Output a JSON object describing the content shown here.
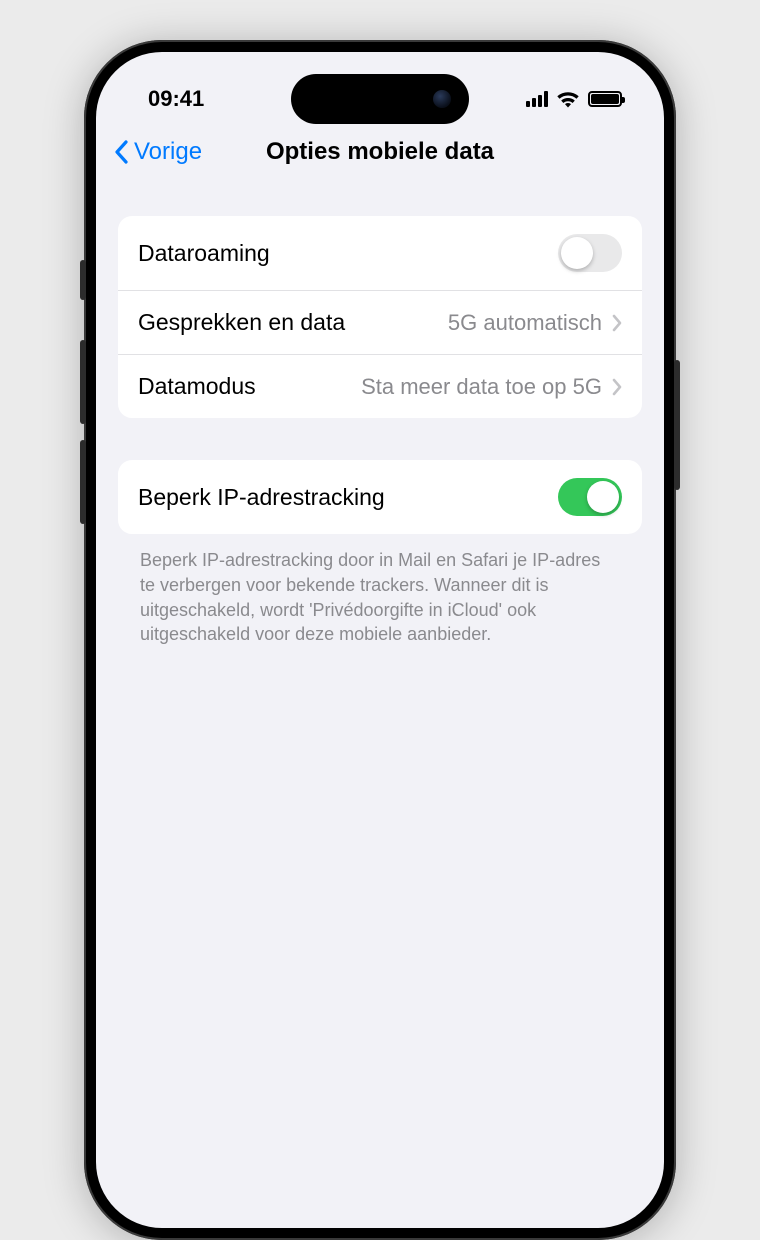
{
  "status": {
    "time": "09:41"
  },
  "nav": {
    "back": "Vorige",
    "title": "Opties mobiele data"
  },
  "group1": {
    "roaming": {
      "label": "Dataroaming",
      "on": false
    },
    "voiceData": {
      "label": "Gesprekken en data",
      "value": "5G automatisch"
    },
    "dataMode": {
      "label": "Datamodus",
      "value": "Sta meer data toe op 5G"
    }
  },
  "group2": {
    "limitIp": {
      "label": "Beperk IP-adrestracking",
      "on": true
    }
  },
  "footer": "Beperk IP-adrestracking door in Mail en Safari je IP-adres te verbergen voor bekende trackers. Wanneer dit is uitgeschakeld, wordt 'Privédoorgifte in iCloud' ook uitgeschakeld voor deze mobiele aanbieder."
}
